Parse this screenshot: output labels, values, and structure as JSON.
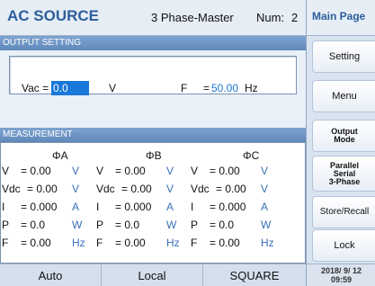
{
  "header": {
    "title": "AC SOURCE",
    "mode": "3 Phase-Master",
    "num_label": "Num:",
    "num_value": "2"
  },
  "menu": {
    "title": "Main Page",
    "items": [
      "Setting",
      "Menu",
      "Output\nMode",
      "Parallel\nSerial\n3-Phase",
      "Store/Recall",
      "Lock"
    ]
  },
  "output_setting": {
    "section_title": "OUTPUT SETTING",
    "vac_label": "Vac  =",
    "vac_value": "0.0",
    "vac_unit": "V",
    "f_label": "F",
    "f_eq": "=",
    "f_value": "50.00",
    "f_unit": "Hz"
  },
  "measurement": {
    "section_title": "MEASUREMENT",
    "phases": [
      "ΦA",
      "ΦB",
      "ΦC"
    ],
    "rows": [
      {
        "label": "V",
        "eq": "= 0.00",
        "unit": "V"
      },
      {
        "label": "Vdc",
        "eq": "= 0.00",
        "unit": "V"
      },
      {
        "label": "I",
        "eq": "= 0.000",
        "unit": "A"
      },
      {
        "label": "P",
        "eq": "= 0.0",
        "unit": "W"
      },
      {
        "label": "F",
        "eq": "= 0.00",
        "unit": "Hz"
      }
    ]
  },
  "status": {
    "auto": "Auto",
    "local": "Local",
    "waveform": "SQUARE",
    "datetime": "2018/ 9/ 12\n09:59"
  }
}
